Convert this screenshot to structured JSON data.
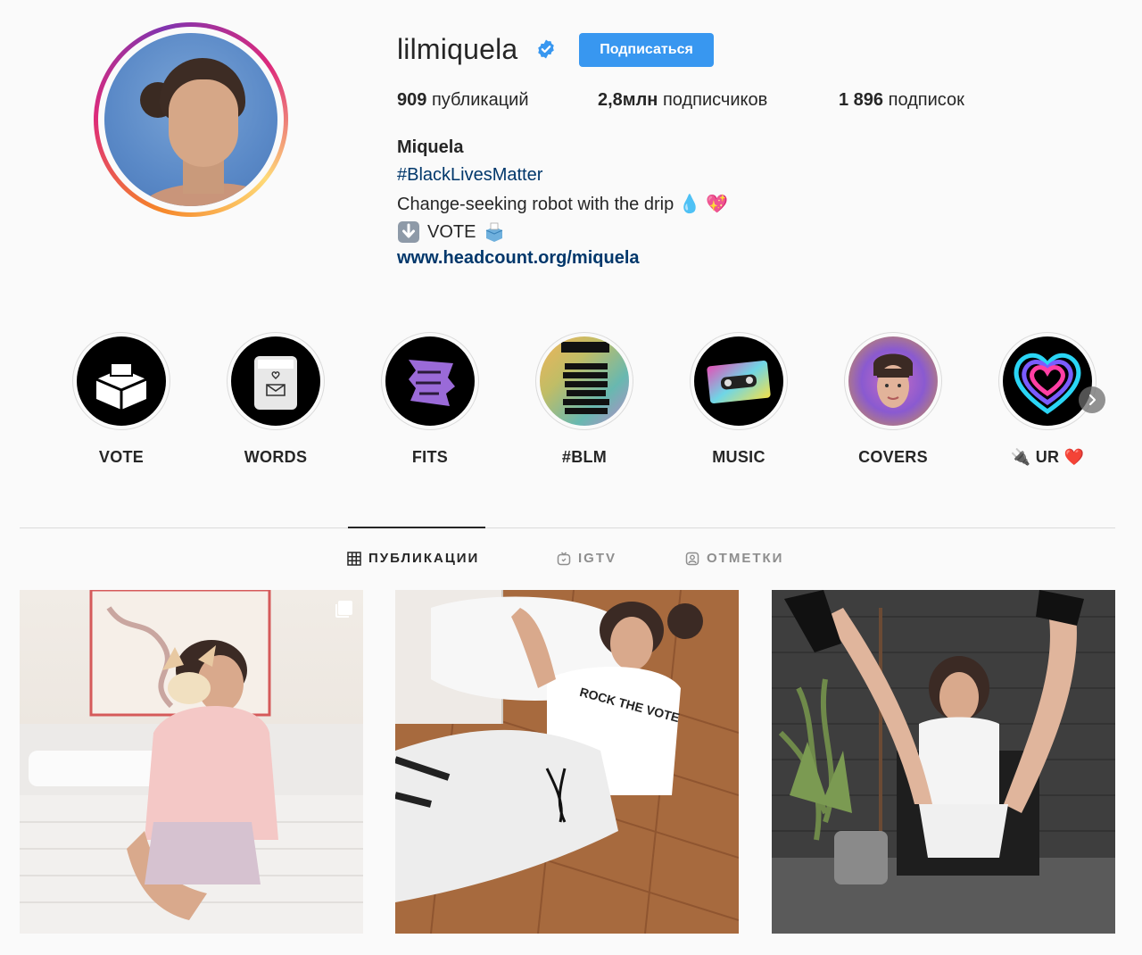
{
  "profile": {
    "username": "lilmiquela",
    "verified": true,
    "follow_label": "Подписаться",
    "stats": {
      "posts_count": "909",
      "posts_label": "публикаций",
      "followers_count": "2,8млн",
      "followers_label": "подписчиков",
      "following_count": "1 896",
      "following_label": "подписок"
    },
    "bio": {
      "name": "Miquela",
      "hashtag": "#BlackLivesMatter",
      "line": "Change-seeking robot with the drip",
      "line_emojis": "💧 💖",
      "vote_text": "VOTE",
      "link": "www.headcount.org/miquela"
    }
  },
  "highlights": [
    {
      "label": "VOTE",
      "icon": "ballot-box-icon"
    },
    {
      "label": "WORDS",
      "icon": "confessions-card-icon"
    },
    {
      "label": "FITS",
      "icon": "fits-sticker-icon"
    },
    {
      "label": "#BLM",
      "icon": "blm-list-icon"
    },
    {
      "label": "MUSIC",
      "icon": "cassette-icon"
    },
    {
      "label": "COVERS",
      "icon": "cover-face-icon"
    },
    {
      "label": "UR",
      "icon": "neon-heart-icon",
      "prefix": "🔌",
      "suffix": "❤️"
    }
  ],
  "highlight_texts": {
    "words_card": "CONFESSIONS",
    "words_size": "64",
    "fits_sticker": "LIFE'S TOO SHORT TO WASTE",
    "blm_header": "organizations you can donate to:",
    "blm_items": [
      "@mnfreedomfund",
      "@colorofchange",
      "@blklivesmatter",
      "@nationalbailout",
      "@byp100",
      "@thecouncilus",
      "@reclaimtheblock",
      "@blackvisionscollective"
    ]
  },
  "tabs": [
    {
      "label": "ПУБЛИКАЦИИ",
      "icon": "grid-icon",
      "active": true
    },
    {
      "label": "IGTV",
      "icon": "igtv-icon",
      "active": false
    },
    {
      "label": "ОТМЕТКИ",
      "icon": "tagged-icon",
      "active": false
    }
  ],
  "posts": [
    {
      "alt": "post-1",
      "multi": true
    },
    {
      "alt": "post-2",
      "multi": false,
      "shirt_text": "ROCK THE VOTE"
    },
    {
      "alt": "post-3",
      "multi": false
    }
  ],
  "colors": {
    "accent": "#3897f0",
    "link": "#00376b",
    "text": "#262626",
    "muted": "#8e8e8e",
    "border": "#dbdbdb",
    "background": "#fafafa"
  }
}
